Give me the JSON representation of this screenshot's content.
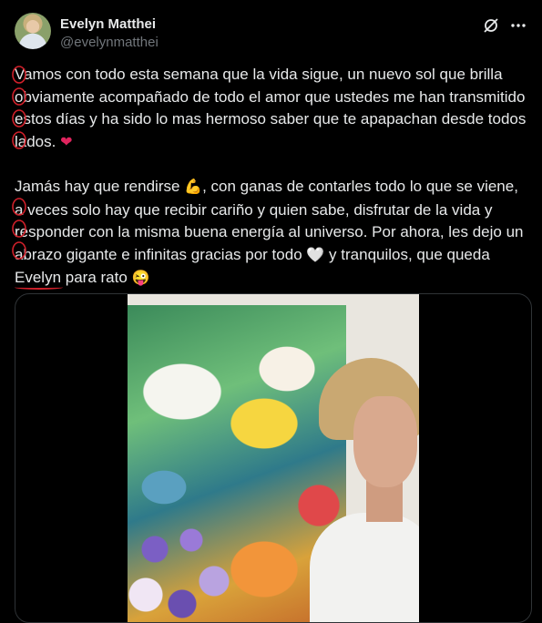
{
  "author": {
    "name": "Evelyn Matthei",
    "handle": "@evelynmatthei"
  },
  "icons": {
    "grok": "grok-icon",
    "more": "more-icon"
  },
  "post": {
    "p1_text": "Vamos con todo esta semana que la vida sigue, un nuevo sol que brilla obviamente acompañado de todo el amor que ustedes me han transmitido estos días y ha sido lo mas hermoso saber que te apapachan desde todos lados.",
    "p1_emoji": "❤",
    "p2_a": "Jamás hay que rendirse",
    "p2_emoji_muscle": "💪",
    "p2_b": ", con ganas de contarles todo lo que se viene, a veces solo hay que recibir cariño y quien sabe, disfrutar de la vida y responder con la misma buena energía al universo. Por ahora, les dejo un abrazo gigante e infinitas gracias por todo",
    "p2_emoji_heart": "🤍",
    "p2_c": "y tranquilos, que queda",
    "p2_underlined": "Evelyn",
    "p2_d": "para rato",
    "p2_emoji_wink": "😜"
  },
  "colors": {
    "background": "#000000",
    "text": "#e7e9ea",
    "muted": "#71767b",
    "annotation_red": "#d0202a"
  }
}
